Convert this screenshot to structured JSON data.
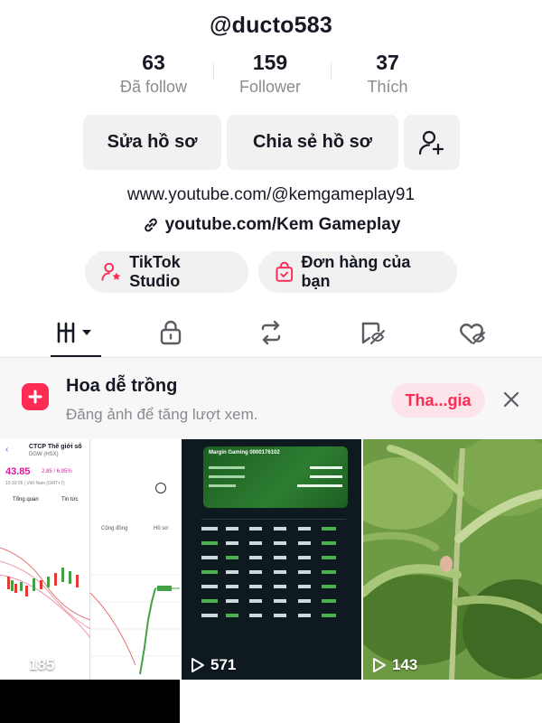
{
  "profile": {
    "username": "@ducto583",
    "stats": [
      {
        "value": "63",
        "label": "Đã follow"
      },
      {
        "value": "159",
        "label": "Follower"
      },
      {
        "value": "37",
        "label": "Thích"
      }
    ]
  },
  "actions": {
    "edit_label": "Sửa hồ sơ",
    "share_label": "Chia sẻ hồ sơ"
  },
  "bio": {
    "text_link": "www.youtube.com/@kemgameplay91",
    "link": "youtube.com/Kem Gameplay"
  },
  "shortcuts": {
    "studio_label": "TikTok Studio",
    "orders_label": "Đơn hàng của bạn"
  },
  "tabs": [
    "videos-grid",
    "private-lock",
    "reposts",
    "favorites",
    "liked"
  ],
  "promo": {
    "title": "Hoa dễ trồng",
    "subtitle": "Đăng ảnh để tăng lượt xem.",
    "join_label": "Tha...gia"
  },
  "videos": [
    {
      "views": "185",
      "thumb": {
        "stock_name": "CTCP Thế giới số",
        "ticker": "DGW (HSX)",
        "price": "43.85",
        "change": "2.85 / 6.95%",
        "time": "15:33:05 | Việt Nam (GMT+7)",
        "tab_overview": "Tổng quan",
        "tab_news": "Tin tức",
        "tab_community": "Cộng đồng",
        "tab_profile": "Hồ sơ"
      }
    },
    {
      "views": "571",
      "thumb": {
        "header": "Margin Gaming 0000176102"
      }
    },
    {
      "views": "143",
      "thumb": {}
    }
  ],
  "colors": {
    "brand_red": "#fe2c55",
    "text": "#161823",
    "muted": "#8a8b91",
    "button_bg": "#f1f1f2"
  }
}
